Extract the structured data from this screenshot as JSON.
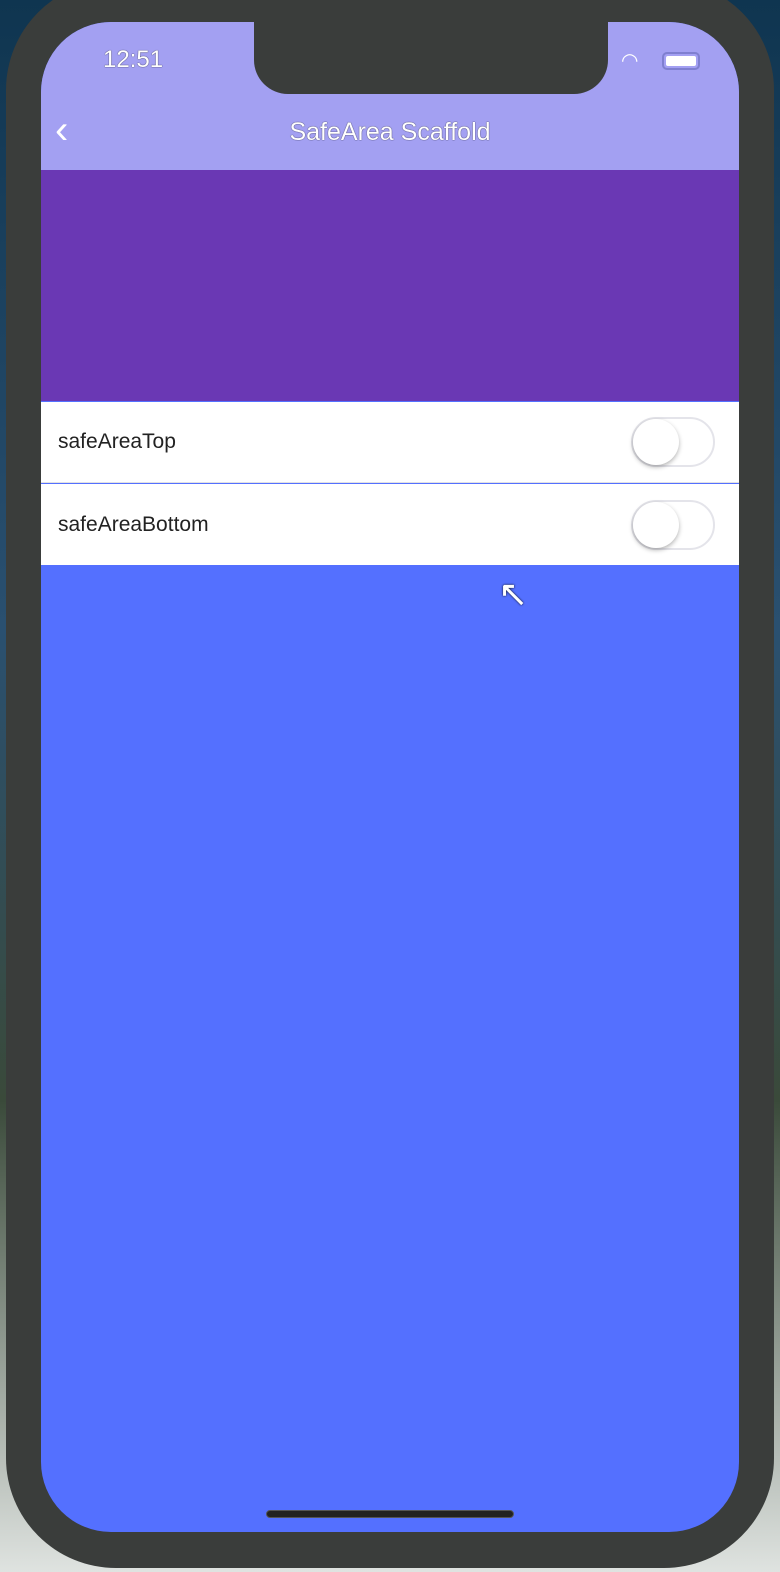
{
  "status_bar": {
    "time": "12:51"
  },
  "nav": {
    "title": "SafeArea Scaffold"
  },
  "settings": [
    {
      "label": "safeAreaTop",
      "enabled": false
    },
    {
      "label": "safeAreaBottom",
      "enabled": false
    }
  ],
  "colors": {
    "nav": "#a3a0f2",
    "header_block": "#6a38b4",
    "body": "#5470ff"
  }
}
